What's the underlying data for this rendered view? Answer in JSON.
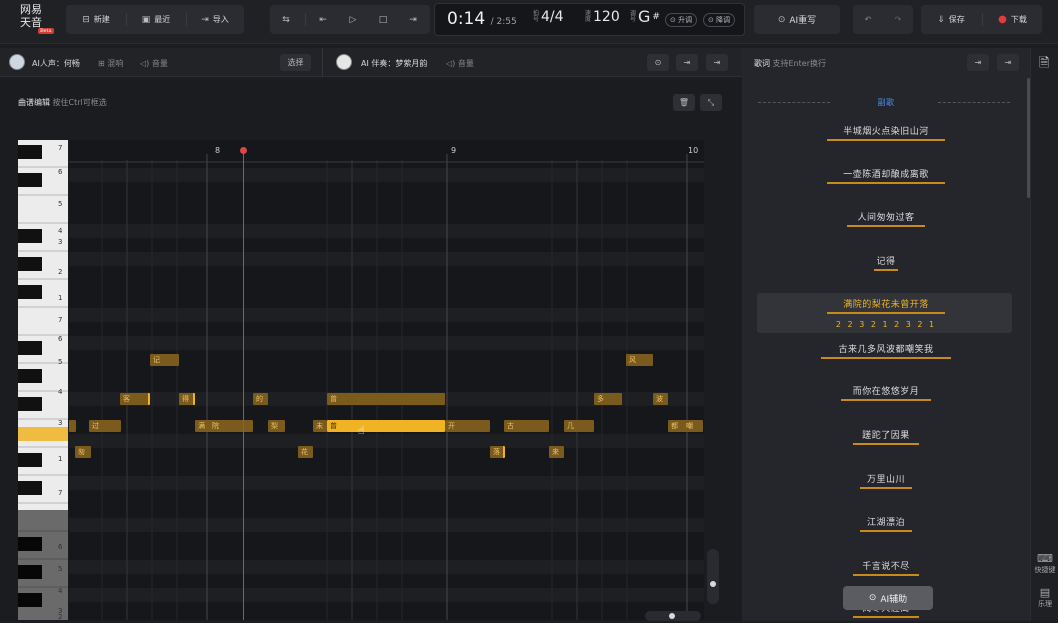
{
  "app": {
    "logo_line1": "网易",
    "logo_line2": "天音",
    "logo_badge": "Beta"
  },
  "toolbar": {
    "new": "新建",
    "recent": "最近",
    "import": "导入",
    "ai_rewrite": "AI重写",
    "save": "保存",
    "download": "下载"
  },
  "info": {
    "time": "0:14",
    "total": "/ 2:55",
    "beat_label": "拍号",
    "time_sig": "4/4",
    "bpm_label": "速度",
    "bpm": "120",
    "key_label": "调号",
    "key": "G",
    "sharp": "#",
    "up": "升调",
    "down": "降调"
  },
  "tracks": {
    "vocal_label": "AI人声：何畅",
    "vocal_effect": "混响",
    "vocal_volume": "音量",
    "select": "选择",
    "acc_label": "AI 伴奏：梦萦月韵",
    "acc_volume": "音量"
  },
  "editor": {
    "title": "曲谱编辑",
    "hint": "按住Ctrl可框选",
    "measures": [
      "8",
      "9",
      "10"
    ]
  },
  "keys": {
    "labels": [
      "7",
      "6",
      "5",
      "4",
      "3",
      "2",
      "1",
      "7",
      "6",
      "5",
      "4",
      "3",
      "1",
      "7",
      "6",
      "5",
      "4",
      "3",
      "2"
    ]
  },
  "notes": [
    {
      "text": "记"
    },
    {
      "text": "风"
    },
    {
      "text": "客"
    },
    {
      "text": "得"
    },
    {
      "text": "的"
    },
    {
      "text": "曾"
    },
    {
      "text": "多"
    },
    {
      "text": "波"
    },
    {
      "text": ""
    },
    {
      "text": "过"
    },
    {
      "text": "满"
    },
    {
      "text": "院"
    },
    {
      "text": "梨"
    },
    {
      "text": "未"
    },
    {
      "text": "曾"
    },
    {
      "text": "开"
    },
    {
      "text": "古"
    },
    {
      "text": "几"
    },
    {
      "text": "都"
    },
    {
      "text": "嘲"
    },
    {
      "text": "匆"
    },
    {
      "text": "花"
    },
    {
      "text": "落"
    },
    {
      "text": "来"
    }
  ],
  "lyrics": {
    "title": "歌词",
    "hint": "支持Enter换行",
    "section": "副歌",
    "lines": [
      "半城烟火点染旧山河",
      "一壶陈酒却酿成离歌",
      "人间匆匆过客",
      "记得",
      "满院的梨花未曾开落",
      "古来几多风波都嘲笑我",
      "而你在悠悠岁月",
      "蹉跎了因果",
      "万里山川",
      "江湖漂泊",
      "千言说不尽",
      "阅尽天涯离"
    ],
    "pitch": "2 2 3 2 1 2 3 2 1",
    "ai_assist": "AI辅助"
  },
  "rail": {
    "shortcuts": "快捷键",
    "theory": "乐理"
  }
}
